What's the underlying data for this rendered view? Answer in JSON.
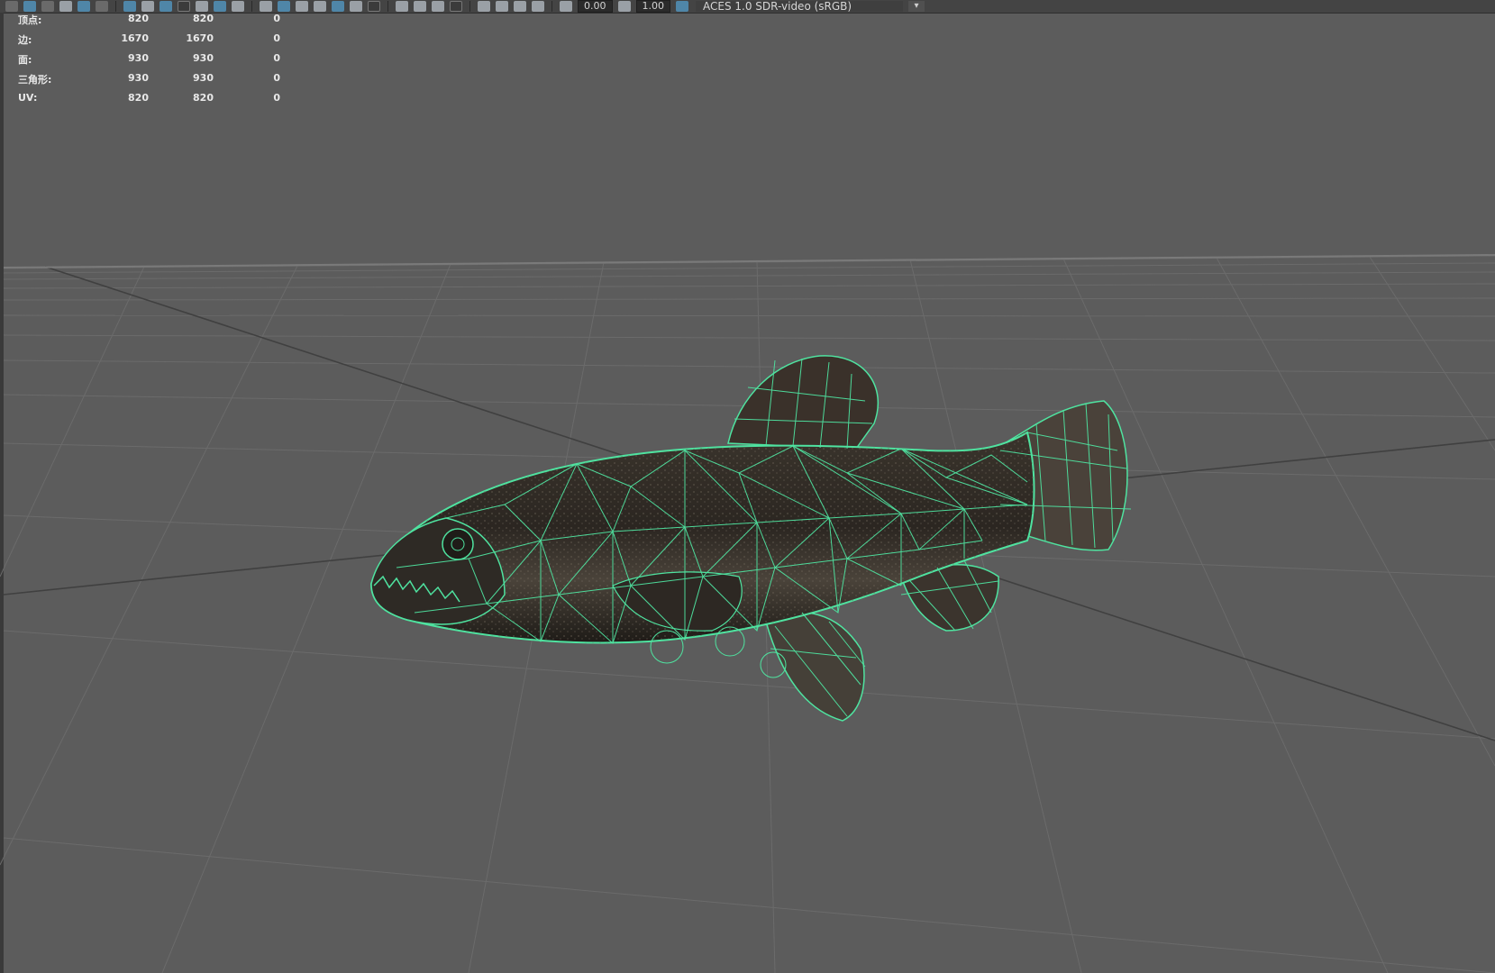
{
  "toolbar": {
    "exposure_value": "0.00",
    "gamma_value": "1.00",
    "color_space": "ACES 1.0 SDR-video (sRGB)",
    "dropdown_glyph": "▾",
    "icons": [
      "select-camera-icon",
      "lock-camera-icon",
      "bookmark-icon",
      "image-plane-icon",
      "camera-attributes-icon",
      "snapshot-icon",
      "grid-icon",
      "film-gate-icon",
      "resolution-gate-icon",
      "gate-mask-icon",
      "field-chart-icon",
      "safe-action-icon",
      "safe-title-icon",
      "wireframe-icon",
      "smooth-shade-icon",
      "default-material-icon",
      "wireframe-on-shaded-icon",
      "textured-icon",
      "use-lights-icon",
      "shadows-icon",
      "ambient-occlusion-icon",
      "motion-blur-icon",
      "anti-aliasing-icon",
      "depth-of-field-icon",
      "isolate-select-icon",
      "xray-icon",
      "xray-joints-icon",
      "xray-components-icon",
      "exposure-icon",
      "gamma-icon",
      "color-management-icon"
    ]
  },
  "hud": {
    "rows": [
      {
        "label": "顶点:",
        "c1": "820",
        "c2": "820",
        "c3": "0"
      },
      {
        "label": "边:",
        "c1": "1670",
        "c2": "1670",
        "c3": "0"
      },
      {
        "label": "面:",
        "c1": "930",
        "c2": "930",
        "c3": "0"
      },
      {
        "label": "三角形:",
        "c1": "930",
        "c2": "930",
        "c3": "0"
      },
      {
        "label": "UV:",
        "c1": "820",
        "c2": "820",
        "c3": "0"
      }
    ]
  },
  "colors": {
    "viewport_bg": "#5c5c5c",
    "grid_line": "#6e6e6e",
    "grid_axis": "#3f3f3f",
    "wireframe": "#4fe3a0",
    "fish_body": "#2a2620",
    "fish_body_light": "#5a5248"
  }
}
